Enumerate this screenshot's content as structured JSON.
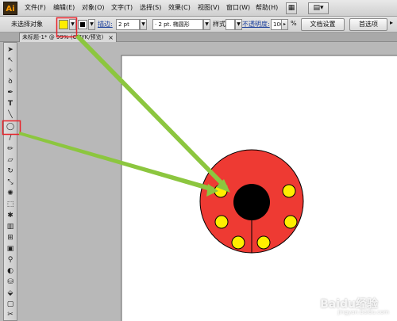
{
  "app": {
    "logo_text": "Ai"
  },
  "menu": {
    "items": [
      "文件(F)",
      "编辑(E)",
      "对象(O)",
      "文字(T)",
      "选择(S)",
      "效果(C)",
      "视图(V)",
      "窗口(W)",
      "帮助(H)"
    ]
  },
  "controlbar": {
    "selection_label": "未选择对象",
    "stroke_label": "描边:",
    "stroke_weight": "2 pt",
    "brush_value": "· 2 pt. 椭圆形",
    "style_label": "样式:",
    "opacity_label": "不透明度:",
    "opacity_value": "100",
    "opacity_unit": "%",
    "doc_setup_button": "文档设置",
    "prefs_button": "首选项",
    "fill_color": "#ffee00",
    "stroke_color": "#000000"
  },
  "document": {
    "tab_title": "未标题-1* @ 99% (CMYK/预览)",
    "close_symbol": "×"
  },
  "tools": [
    "selection-tool-icon",
    "direct-selection-tool-icon",
    "magic-wand-tool-icon",
    "lasso-tool-icon",
    "pen-tool-icon",
    "type-tool-icon",
    "line-segment-tool-icon",
    "ellipse-tool-icon",
    "paintbrush-tool-icon",
    "pencil-tool-icon",
    "eraser-tool-icon",
    "rotate-tool-icon",
    "scale-tool-icon",
    "warp-tool-icon",
    "free-transform-tool-icon",
    "symbol-sprayer-tool-icon",
    "column-graph-tool-icon",
    "mesh-tool-icon",
    "gradient-tool-icon",
    "eyedropper-tool-icon",
    "blend-tool-icon",
    "live-paint-bucket-tool-icon",
    "live-paint-selection-tool-icon",
    "artboard-tool-icon",
    "slice-tool-icon",
    "hand-tool-icon"
  ],
  "artwork": {
    "body_color": "#ee3a33",
    "head_color": "#000000",
    "spot_color": "#ffee00",
    "arrow_color": "#8cc63f",
    "highlight_color": "#e8232a"
  },
  "watermark": {
    "main": "Baidu经验",
    "sub": "jingyan.baidu.com"
  }
}
